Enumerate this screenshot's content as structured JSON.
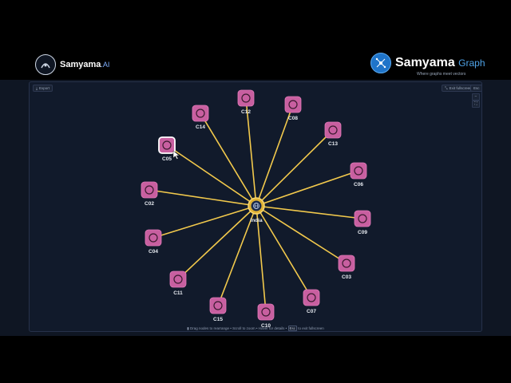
{
  "header": {
    "left_brand": "Samyama",
    "left_brand_suffix": ".AI",
    "right_brand": "Samyama",
    "right_brand_suffix": "Graph",
    "right_tagline": "Where graphs meet vectors"
  },
  "toolbar": {
    "export_label": "Export",
    "fullscreen_label": "Exit fullscreen",
    "esc_key": "Esc",
    "zoom_in": "+",
    "zoom_out": "−",
    "fit": "⛶"
  },
  "hint": {
    "part1": "Drag nodes to rearrange",
    "part2": "Scroll to zoom",
    "part3": "Hover for details",
    "key": "Esc",
    "part4": "to exit fullscreen"
  },
  "graph": {
    "center": {
      "label": "India",
      "icon": "globe-icon",
      "color": "#f2c94c"
    },
    "node_color": "#c85fa0",
    "edge_color": "#f2c94c",
    "nodes": [
      {
        "label": "C12"
      },
      {
        "label": "C08"
      },
      {
        "label": "C14"
      },
      {
        "label": "C13"
      },
      {
        "label": "C05"
      },
      {
        "label": "C06"
      },
      {
        "label": "C02"
      },
      {
        "label": "C09"
      },
      {
        "label": "C04"
      },
      {
        "label": "C03"
      },
      {
        "label": "C11"
      },
      {
        "label": "C07"
      },
      {
        "label": "C15"
      },
      {
        "label": "C10"
      }
    ]
  }
}
